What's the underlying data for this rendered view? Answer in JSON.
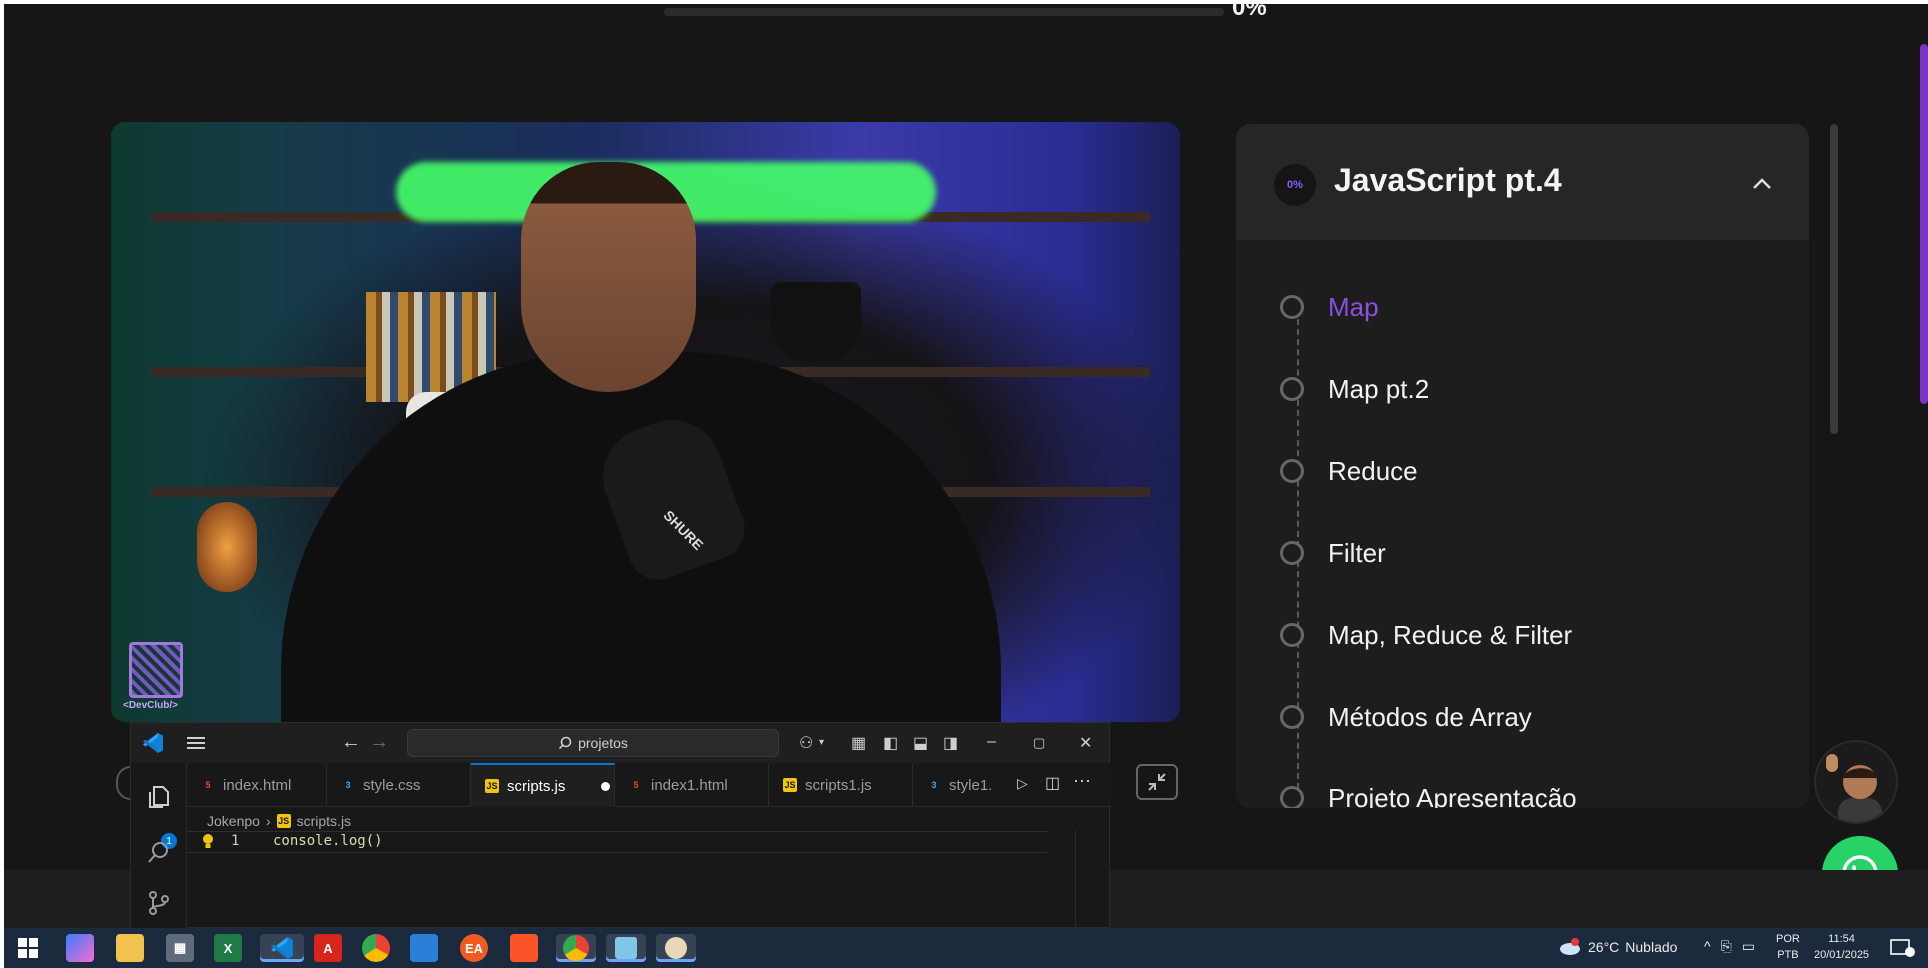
{
  "course": {
    "top_progress_label": "0%",
    "module": {
      "progress_label": "0%",
      "title": "JavaScript pt.4",
      "lessons": [
        {
          "label": "Map",
          "active": true
        },
        {
          "label": "Map pt.2"
        },
        {
          "label": "Reduce"
        },
        {
          "label": "Filter"
        },
        {
          "label": "Map, Reduce & Filter"
        },
        {
          "label": "Métodos de Array"
        },
        {
          "label": "Projeto Apresentação"
        }
      ]
    }
  },
  "video": {
    "watermark_label": "<DevClub/>",
    "mic_brand": "SHURE"
  },
  "vscode": {
    "search_placeholder": "projetos",
    "tabs": [
      {
        "label": "index.html",
        "type": "html"
      },
      {
        "label": "style.css",
        "type": "css"
      },
      {
        "label": "scripts.js",
        "type": "js",
        "active": true,
        "dirty": true
      },
      {
        "label": "index1.html",
        "type": "html"
      },
      {
        "label": "scripts1.js",
        "type": "js"
      },
      {
        "label": "style1.",
        "type": "css"
      }
    ],
    "breadcrumb": [
      "Jokenpo",
      "scripts.js"
    ],
    "explorer_badge": "1",
    "editor": {
      "line_number": "1",
      "code": "console.log()"
    }
  },
  "taskbar": {
    "weather": {
      "temperature": "26°C",
      "condition": "Nublado",
      "alert_badge": "1"
    },
    "language": {
      "line1": "POR",
      "line2": "PTB"
    },
    "clock": {
      "time": "11:54",
      "date": "20/01/2025"
    },
    "notification_count": "2",
    "apps": [
      "copilot-icon",
      "file-explorer-icon",
      "calculator-icon",
      "excel-icon",
      "vscode-icon",
      "acrobat-icon",
      "chrome-icon",
      "app-icon",
      "ea-icon",
      "brave-icon",
      "chrome-profile-icon",
      "notepad-icon",
      "paint-icon"
    ]
  },
  "colors": {
    "accent": "#8c4fe0",
    "whatsapp": "#27d367",
    "vscode_blue": "#0078d4"
  }
}
